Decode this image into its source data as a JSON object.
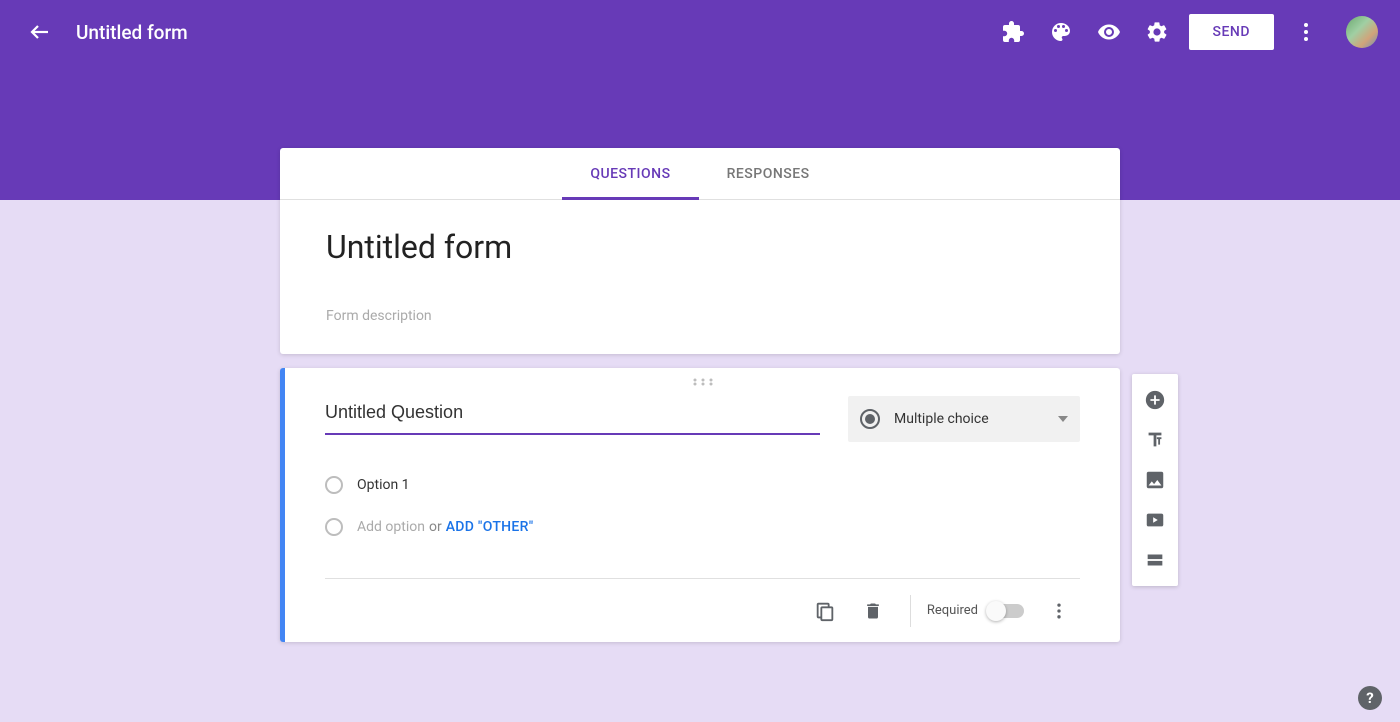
{
  "header": {
    "doc_title": "Untitled form",
    "send_label": "SEND"
  },
  "tabs": {
    "questions": "QUESTIONS",
    "responses": "RESPONSES"
  },
  "form": {
    "title": "Untitled form",
    "description_placeholder": "Form description"
  },
  "question": {
    "title": "Untitled Question",
    "type_label": "Multiple choice",
    "option1": "Option 1",
    "add_option": "Add option",
    "or_text": "or",
    "add_other": "ADD \"OTHER\"",
    "required_label": "Required"
  },
  "colors": {
    "primary": "#673ab7",
    "accent": "#4285f4",
    "link": "#1a73e8"
  }
}
